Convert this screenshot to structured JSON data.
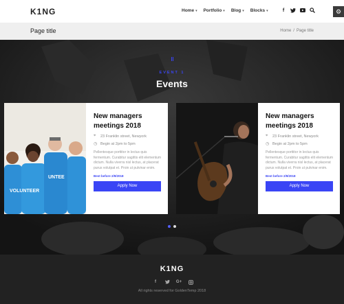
{
  "header": {
    "logo": "K1NG",
    "nav": [
      {
        "label": "Home"
      },
      {
        "label": "Portfolio"
      },
      {
        "label": "Blog"
      },
      {
        "label": "Blocks"
      }
    ],
    "social": [
      "facebook-icon",
      "twitter-icon",
      "youtube-icon"
    ],
    "search_icon": "search-icon",
    "settings_icon": "gear-icon"
  },
  "titlebar": {
    "title": "Page title",
    "breadcrumb_home": "Home",
    "breadcrumb_sep": "/",
    "breadcrumb_current": "Page title"
  },
  "events": {
    "subtitle": "EVENT 1",
    "title": "Events",
    "accent_color": "#3a45f5",
    "cards": [
      {
        "title": "New managers meetings 2018",
        "address": "23 Franklin street, Newyork",
        "time": "Begin at 2pm to 5pm",
        "description": "Pellentesque porttitor in lectus quis fermentum. Curabitur sagittis elit elementum dictum. Nulla viverra nisl lectus, at placerat purus volutpat et. Proin ut pulvinar enim.",
        "best_before": "Best before 2/9/2018",
        "button": "Apply Now"
      },
      {
        "title": "New managers meetings 2018",
        "address": "23 Franklin street, Newyork",
        "time": "Begin at 2pm to 5pm",
        "description": "Pellentesque porttitor in lectus quis fermentum. Curabitur sagittis elit elementum dictum. Nulla viverra nisl lectus, at placerat purus volutpat et. Proin ut pulvinar enim.",
        "best_before": "Best before 2/9/2018",
        "button": "Apply Now"
      }
    ],
    "pagination": {
      "pages": 2,
      "current": 1
    }
  },
  "footer": {
    "logo": "K1NG",
    "social": [
      "facebook-icon",
      "twitter-icon",
      "google-plus-icon",
      "instagram-icon"
    ],
    "copyright": "All rights reserved for GoldenTemp 2018"
  }
}
